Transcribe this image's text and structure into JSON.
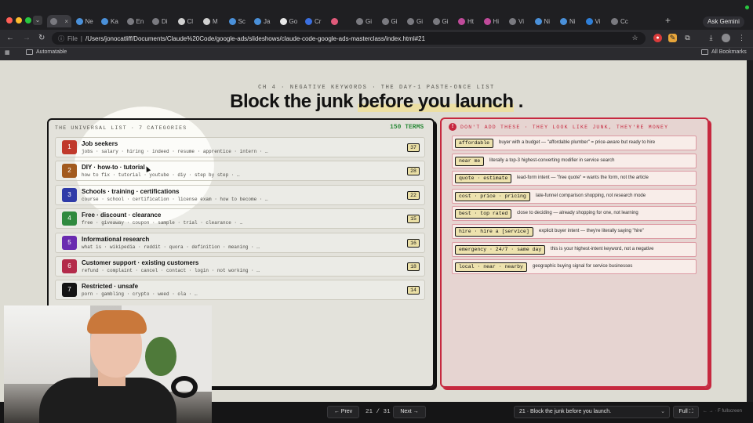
{
  "browser": {
    "tabs": [
      {
        "label": "",
        "color": "#7a7a80",
        "active": true
      },
      {
        "label": "Ne",
        "color": "#4a90d9"
      },
      {
        "label": "Ka",
        "color": "#4a90d9"
      },
      {
        "label": "En",
        "color": "#7a7a80"
      },
      {
        "label": "Di",
        "color": "#7a7a80"
      },
      {
        "label": "Cl",
        "color": "#d0d0d0"
      },
      {
        "label": "M",
        "color": "#d0d0d0"
      },
      {
        "label": "Sc",
        "color": "#4a90d9"
      },
      {
        "label": "Ja",
        "color": "#4a90d9"
      },
      {
        "label": "Go",
        "color": "#e8e8e8"
      },
      {
        "label": "Cr",
        "color": "#3b6fe0"
      },
      {
        "label": "",
        "color": "#e05a7a"
      },
      {
        "label": "Gi",
        "color": "#7a7a80"
      },
      {
        "label": "Gi",
        "color": "#7a7a80"
      },
      {
        "label": "Gi",
        "color": "#7a7a80"
      },
      {
        "label": "Gi",
        "color": "#7a7a80"
      },
      {
        "label": "Ht",
        "color": "#c04a9a"
      },
      {
        "label": "Hi",
        "color": "#c04a9a"
      },
      {
        "label": "Vi",
        "color": "#7a7a80"
      },
      {
        "label": "Ni",
        "color": "#4a90d9"
      },
      {
        "label": "Ni",
        "color": "#4a90d9"
      },
      {
        "label": "Vi",
        "color": "#2f7fd8"
      },
      {
        "label": "Cc",
        "color": "#7a7a80"
      }
    ],
    "ask_gemini": "Ask Gemini",
    "address_label": "File",
    "url": "/Users/jonocatliff/Documents/Claude%20Code/google-ads/slideshows/claude-code-google-ads-masterclass/index.html#21",
    "bookmark_left": "Automatable",
    "bookmark_right": "All Bookmarks"
  },
  "slide": {
    "eyebrow": "CH 4 · NEGATIVE KEYWORDS · THE DAY-1 PASTE-ONCE LIST",
    "title_plain": "Block the junk",
    "title_highlight": "before you launch",
    "title_end": ".",
    "left": {
      "heading": "THE UNIVERSAL LIST · 7 CATEGORIES",
      "terms_count": "150 TERMS",
      "categories": [
        {
          "num": "1",
          "color": "#c0392b",
          "name": "Job seekers",
          "terms": "jobs · salary · hiring · indeed · resume · apprentice · intern · …",
          "count": "37"
        },
        {
          "num": "2",
          "color": "#a25a1e",
          "name": "DIY · how-to · tutorial",
          "terms": "how to fix · tutorial · youtube · diy · step by step · …",
          "count": "28"
        },
        {
          "num": "3",
          "color": "#2f3ba8",
          "name": "Schools · training · certifications",
          "terms": "course · school · certification · license exam · how to become · …",
          "count": "22"
        },
        {
          "num": "4",
          "color": "#2f8a3e",
          "name": "Free · discount · clearance",
          "terms": "free · giveaway · coupon · sample · trial · clearance · …",
          "count": "15"
        },
        {
          "num": "5",
          "color": "#6a2bb0",
          "name": "Informational research",
          "terms": "what is · wikipedia · reddit · quora · definition · meaning · …",
          "count": "16"
        },
        {
          "num": "6",
          "color": "#b32b4a",
          "name": "Customer support · existing customers",
          "terms": "refund · complaint · cancel · contact · login · not working · …",
          "count": "18"
        },
        {
          "num": "7",
          "color": "#141414",
          "name": "Restricted · unsafe",
          "terms": "porn · gambling · crypto · weed · ola · …",
          "count": "14"
        }
      ]
    },
    "right": {
      "heading": "DON'T ADD THESE · THEY LOOK LIKE JUNK, THEY'RE MONEY",
      "items": [
        {
          "chip": "affordable",
          "desc": "buyer with a budget — \"affordable plumber\" = price-aware but ready to hire"
        },
        {
          "chip": "near me",
          "desc": "literally a top-3 highest-converting modifier in service search"
        },
        {
          "chip": "quote · estimate",
          "desc": "lead-form intent — \"free quote\" = wants the form, not the article"
        },
        {
          "chip": "cost · price · pricing",
          "desc": "late-funnel comparison shopping, not research mode"
        },
        {
          "chip": "best · top rated",
          "desc": "close to deciding — already shopping for one, not learning"
        },
        {
          "chip": "hire · hire a [service]",
          "desc": "explicit buyer intent — they're literally saying \"hire\""
        },
        {
          "chip": "emergency · 24/7 · same day",
          "desc": "this is your highest-intent keyword, not a negative"
        },
        {
          "chip": "local · near · nearby",
          "desc": "geographic buying signal for service businesses"
        }
      ]
    }
  },
  "presenter": {
    "prev": "← Prev",
    "counter": "21 / 31",
    "next": "Next →",
    "slide_select": "21 · Block the junk before you launch.",
    "full": "Full ⛶",
    "hint": "← → · F fullscreen"
  }
}
